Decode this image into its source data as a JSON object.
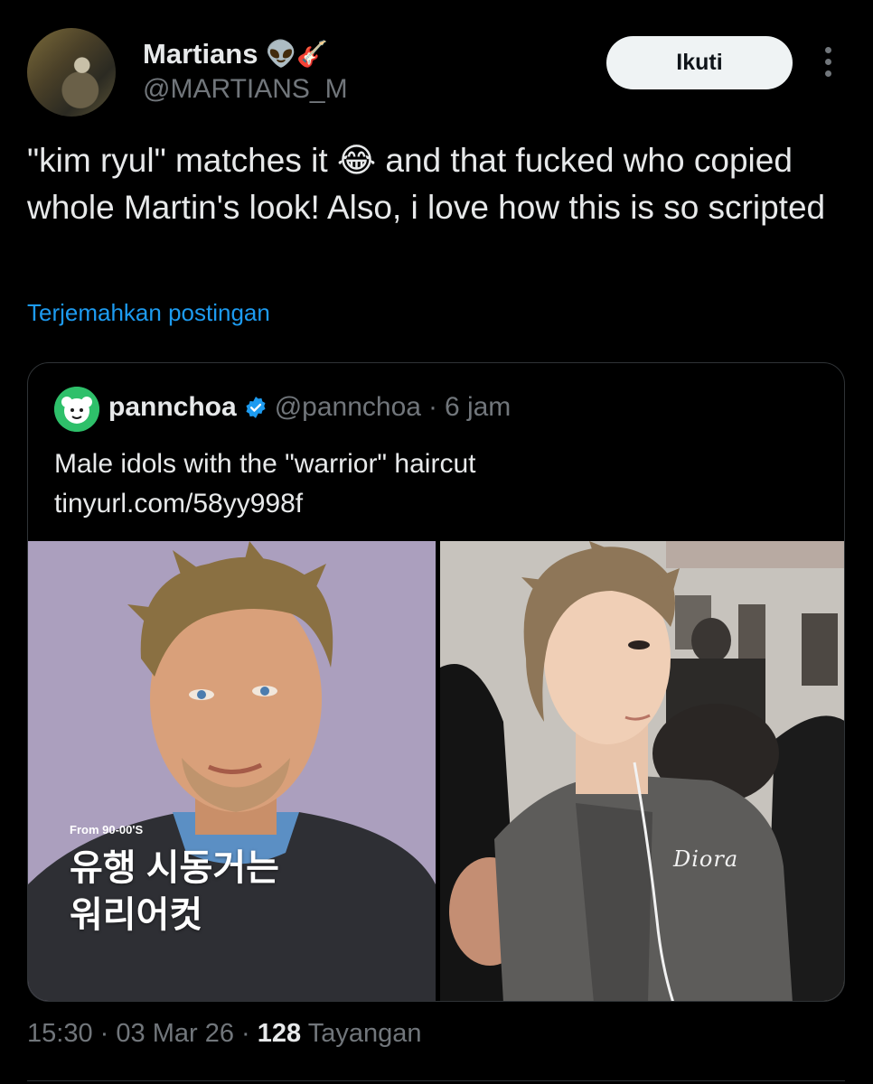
{
  "author": {
    "display_name": "Martians",
    "name_emojis": "👽🎸",
    "handle": "@MARTIANS_M"
  },
  "actions": {
    "follow_label": "Ikuti"
  },
  "tweet": {
    "text_before_emoji": "\"kim ryul\" matches it ",
    "emoji": "😂",
    "text_after_emoji": " and that fucked who copied whole Martin's look! Also, i love how this is so scripted",
    "translate_label": "Terjemahkan postingan"
  },
  "quote": {
    "name": "pannchoa",
    "verified_badge": "✔",
    "handle": "@pannchoa",
    "separator": "·",
    "time": "6 jam",
    "text_line1": "Male idols with the \"warrior\" haircut",
    "link": "tinyurl.com/58yy998f",
    "image_left": {
      "overlay_small": "From 90-00'S",
      "overlay_line1": "유행 시동거는",
      "overlay_line2": "워리어컷"
    },
    "image_right": {
      "watermark": "Diora"
    }
  },
  "footer": {
    "time": "15:30",
    "sep1": "·",
    "date": "03 Mar 26",
    "sep2": "·",
    "views_count": "128",
    "views_label": "Tayangan"
  },
  "colors": {
    "background": "#000000",
    "text": "#e7e9ea",
    "muted": "#71767b",
    "link": "#1d9bf0",
    "verified": "#1d9bf0",
    "border": "#2f3336"
  }
}
